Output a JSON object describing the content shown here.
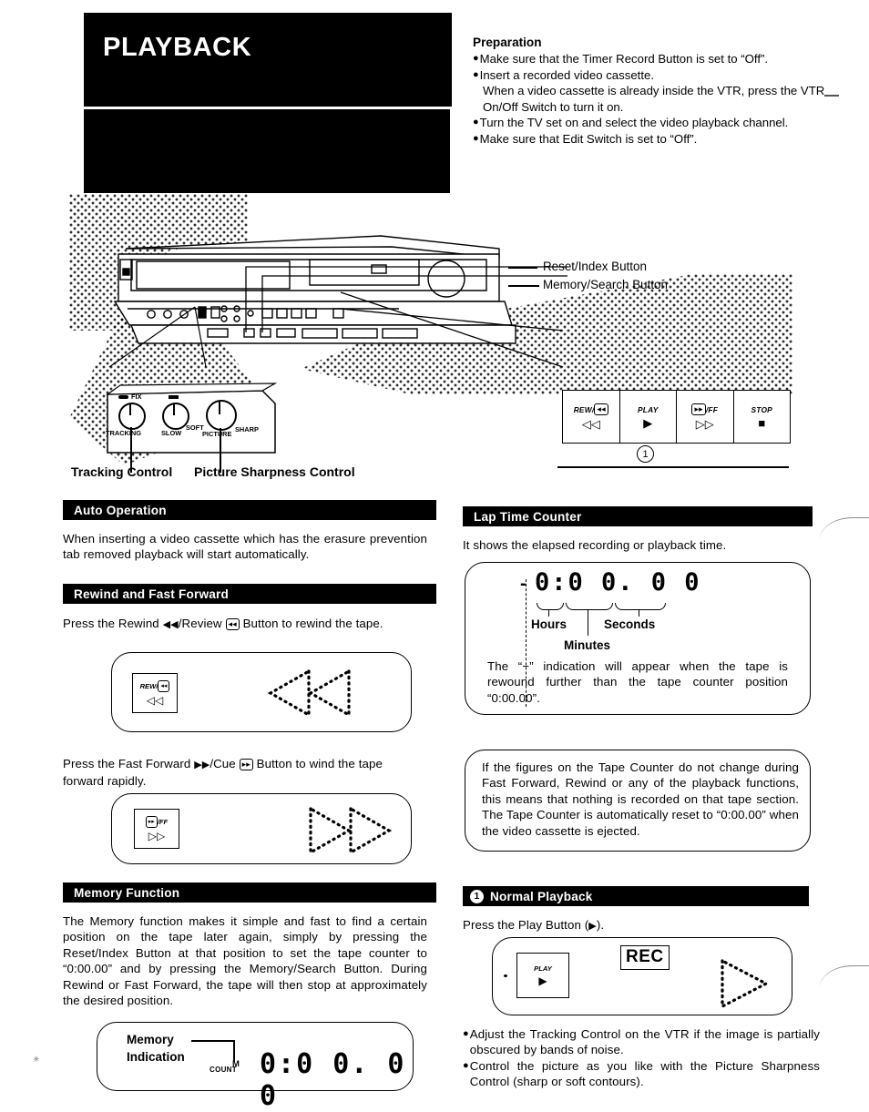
{
  "page": {
    "title": "PLAYBACK"
  },
  "preparation": {
    "heading": "Preparation",
    "items": [
      "Make sure that the Timer Record Button is set to “Off”.",
      "Insert a recorded video cassette.",
      "When a video cassette is already inside the VTR, press the VTR On/Off Switch to turn it on.",
      "Turn the TV set on and select the video playback channel.",
      "Make sure that Edit Switch is set to “Off”."
    ],
    "bullet": "●"
  },
  "diagram": {
    "callouts": [
      "Reset/Index Button",
      "Memory/Search Button"
    ],
    "knob_panel": {
      "fix_label": "FIX",
      "tracking_label": "TRACKING",
      "slow_label": "SLOW",
      "soft_label": "SOFT",
      "picture_label": "PICTURE",
      "sharp_label": "SHARP"
    },
    "knob_captions": [
      "Tracking Control",
      "Picture Sharpness Control"
    ],
    "transport": {
      "buttons": [
        {
          "name": "REW/",
          "key": "◂◂",
          "glyph": "◁◁"
        },
        {
          "name": "PLAY",
          "key": "",
          "glyph": "▶"
        },
        {
          "name": "/FF",
          "key": "▸▸",
          "glyph": "▷▷"
        },
        {
          "name": "STOP",
          "key": "",
          "glyph": "■"
        }
      ],
      "step_number": "1"
    }
  },
  "left_column": {
    "auto_operation": {
      "heading": "Auto Operation",
      "text": "When inserting a video cassette which has the erasure prevention tab removed playback will start automatically."
    },
    "rewind_ff": {
      "heading": "Rewind and Fast Forward",
      "rewind_text_a": "Press the Rewind",
      "rewind_glyph": "◀◀",
      "rewind_text_b": "/Review",
      "rewind_key": "◂◂",
      "rewind_text_c": "Button to rewind the tape.",
      "rewind_button_name": "REW/",
      "rewind_button_key": "◂◂",
      "rewind_button_glyph": "◁◁",
      "ff_text_a": "Press the Fast Forward",
      "ff_glyph": "▶▶",
      "ff_text_b": "/Cue",
      "ff_key": "▸▸",
      "ff_text_c": "Button to wind the tape forward rapidly.",
      "ff_button_name": "/FF",
      "ff_button_key": "▸▸",
      "ff_button_glyph": "▷▷"
    },
    "memory_function": {
      "heading": "Memory Function",
      "text": "The Memory function makes it simple and fast to find a certain position on the tape later again, simply by pressing the Reset/Index Button at that position to set the tape counter to “0:00.00” and by pressing the Memory/Search Button. During Rewind or Fast Forward, the tape will then stop at approximately the desired position.",
      "display": {
        "label_line1": "Memory",
        "label_line2": "Indication",
        "count_label": "COUNT",
        "m_label": "M",
        "value": "0:0 0. 0 0"
      }
    }
  },
  "right_column": {
    "lap_time_counter": {
      "heading": "Lap Time Counter",
      "intro": "It shows the elapsed recording or playback time.",
      "display_value": "0:0 0. 0 0",
      "minus_sign": "-",
      "labels": {
        "hours": "Hours",
        "minutes": "Minutes",
        "seconds": "Seconds"
      },
      "note": "The “−” indication will appear when the tape is rewound further than the tape counter position “0:00.00”."
    },
    "tape_counter_note": "If the figures on the Tape Counter do not change during Fast Forward, Rewind or any of the playback functions, this means that nothing is recorded on that tape section. The Tape Counter is automatically reset to “0:00.00” when the video cassette is ejected.",
    "normal_playback": {
      "number": "1",
      "heading": "Normal Playback",
      "instruction_a": "Press the Play Button (",
      "instruction_glyph": "▶",
      "instruction_b": ").",
      "rec_label": "REC",
      "play_button_name": "PLAY",
      "play_button_glyph": "▶",
      "bullets": [
        "Adjust the Tracking Control on the VTR if the image is partially obscured by bands of noise.",
        "Control the picture as you like with the Picture Sharpness Control (sharp or soft contours)."
      ],
      "bullet": "●"
    }
  },
  "colors": {
    "ink": "#000000",
    "paper": "#ffffff"
  }
}
